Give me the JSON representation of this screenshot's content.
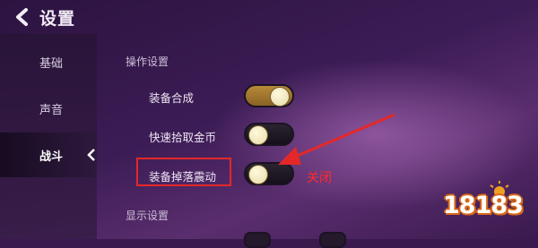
{
  "header": {
    "title": "设置",
    "back_icon": "chevron-left-icon"
  },
  "sidebar": {
    "items": [
      {
        "label": "基础",
        "active": false
      },
      {
        "label": "声音",
        "active": false
      },
      {
        "label": "战斗",
        "active": true
      }
    ]
  },
  "content": {
    "sections": [
      {
        "label": "操作设置",
        "rows": [
          {
            "label": "装备合成",
            "toggle_on": true
          },
          {
            "label": "快速拾取金币",
            "toggle_on": false
          },
          {
            "label": "装备掉落震动",
            "toggle_on": false
          }
        ]
      },
      {
        "label": "显示设置"
      }
    ]
  },
  "annotation": {
    "label": "关闭",
    "color": "#e42828"
  },
  "watermark": {
    "text": "18183"
  },
  "colors": {
    "toggle_on": "#b78a3a",
    "toggle_off": "#15101a",
    "background": "#3a1a4e"
  }
}
